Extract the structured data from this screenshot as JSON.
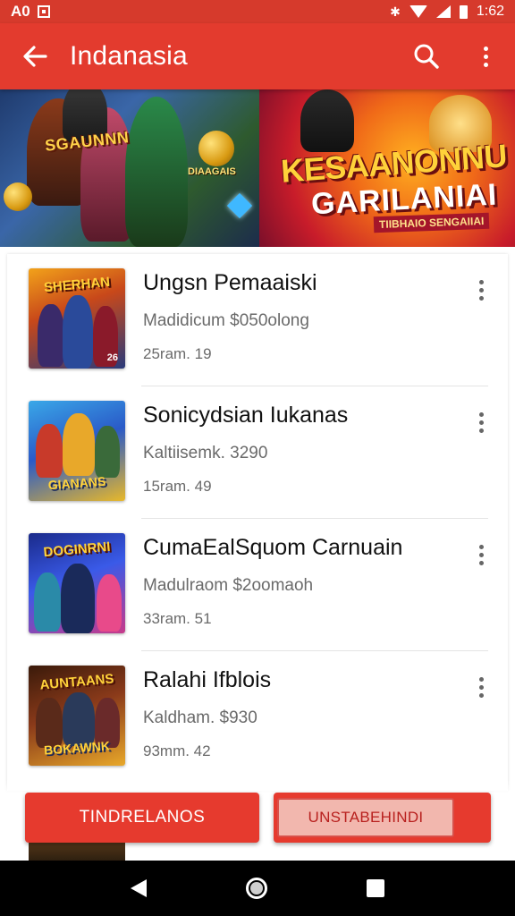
{
  "status_bar": {
    "left_text": "A0",
    "time": "1:62",
    "icons": [
      "notification-box-icon",
      "bluetooth-icon",
      "wifi-icon",
      "signal-icon",
      "battery-icon"
    ]
  },
  "app_bar": {
    "title": "Indanasia",
    "icons": [
      "back-arrow-icon",
      "search-icon",
      "more-vert-icon"
    ],
    "color": "#e33b2e"
  },
  "banner": {
    "left": {
      "text_main": "SGAUNNN",
      "text_badge": "DIAAGAIS"
    },
    "right": {
      "title": "KESAANONNU",
      "subtitle": "GARILANIAI",
      "tag": "TIIBHAIO SENGAIIAI"
    }
  },
  "items": [
    {
      "title": "Ungsn Pemaaiski",
      "subtitle": "Madidicum  $050olong",
      "meta": "25ram. 19",
      "thumb_label_top": "SHERHAN",
      "thumb_label_bottom": "",
      "thumb_corner": "26"
    },
    {
      "title": "Sonicydsian Iukanas",
      "subtitle": "Kaltiisemk. 3290",
      "meta": "15ram. 49",
      "thumb_label_top": "",
      "thumb_label_bottom": "GIANANS",
      "thumb_corner": ""
    },
    {
      "title": "CumaEalSquom Carnuain",
      "subtitle": "Madulraom  $2oomaoh",
      "meta": "33ram. 51",
      "thumb_label_top": "DOGINRNI",
      "thumb_label_bottom": "",
      "thumb_corner": ""
    },
    {
      "title": "Ralahi Ifblois",
      "subtitle": "Kaldham. $930",
      "meta": "93mm. 42",
      "thumb_label_top": "AUNTAANS",
      "thumb_label_bottom": "BOKAWNK",
      "thumb_corner": ""
    }
  ],
  "buttons": {
    "primary": "TINDRELANOS",
    "secondary": "UNSTABEHINDI"
  },
  "nav_bar": {
    "icons": [
      "nav-back-icon",
      "nav-home-icon",
      "nav-recents-icon"
    ]
  },
  "colors": {
    "accent": "#e33b2e",
    "status_bar": "#d63a2c",
    "button": "#e63a2e",
    "text_primary": "#111111",
    "text_secondary": "#6a6a6a"
  }
}
